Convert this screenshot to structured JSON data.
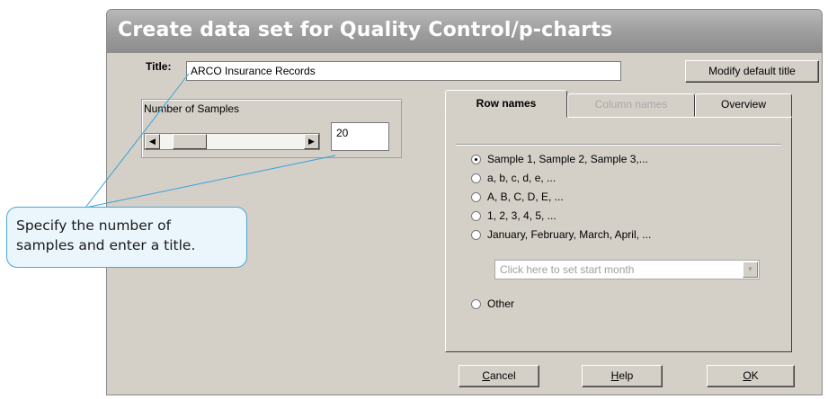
{
  "dialog": {
    "title": "Create data set for Quality Control/p-charts"
  },
  "title_row": {
    "label": "Title:",
    "value": "ARCO Insurance Records",
    "modify_button": "Modify default title"
  },
  "samples": {
    "label": "Number of Samples",
    "value": "20",
    "scroll_left": "◀",
    "scroll_right": "▶"
  },
  "tabs": [
    {
      "label": "Row names",
      "state": "active"
    },
    {
      "label": "Column names",
      "state": "disabled"
    },
    {
      "label": "Overview",
      "state": "normal"
    }
  ],
  "row_names": {
    "options": [
      {
        "label": "Sample 1, Sample 2, Sample 3,...",
        "selected": true
      },
      {
        "label": "a, b, c, d, e, ...",
        "selected": false
      },
      {
        "label": "A, B, C, D, E, ...",
        "selected": false
      },
      {
        "label": "1, 2, 3, 4, 5, ...",
        "selected": false
      },
      {
        "label": "January, February, March, April, ...",
        "selected": false
      },
      {
        "label": "Other",
        "selected": false
      }
    ],
    "month_placeholder": "Click here to set start month"
  },
  "buttons": {
    "cancel_prefix": "C",
    "cancel_rest": "ancel",
    "help_prefix": "H",
    "help_rest": "elp",
    "ok_prefix": "O",
    "ok_rest": "K"
  },
  "callout": {
    "line1": "Specify the number of",
    "line2": "samples and enter a title."
  },
  "colors": {
    "dialog_face": "#d4d0c8",
    "callout_border": "#4aa8d8",
    "callout_fill": "#eaf6fc",
    "leader_line": "#3aa0d8"
  }
}
